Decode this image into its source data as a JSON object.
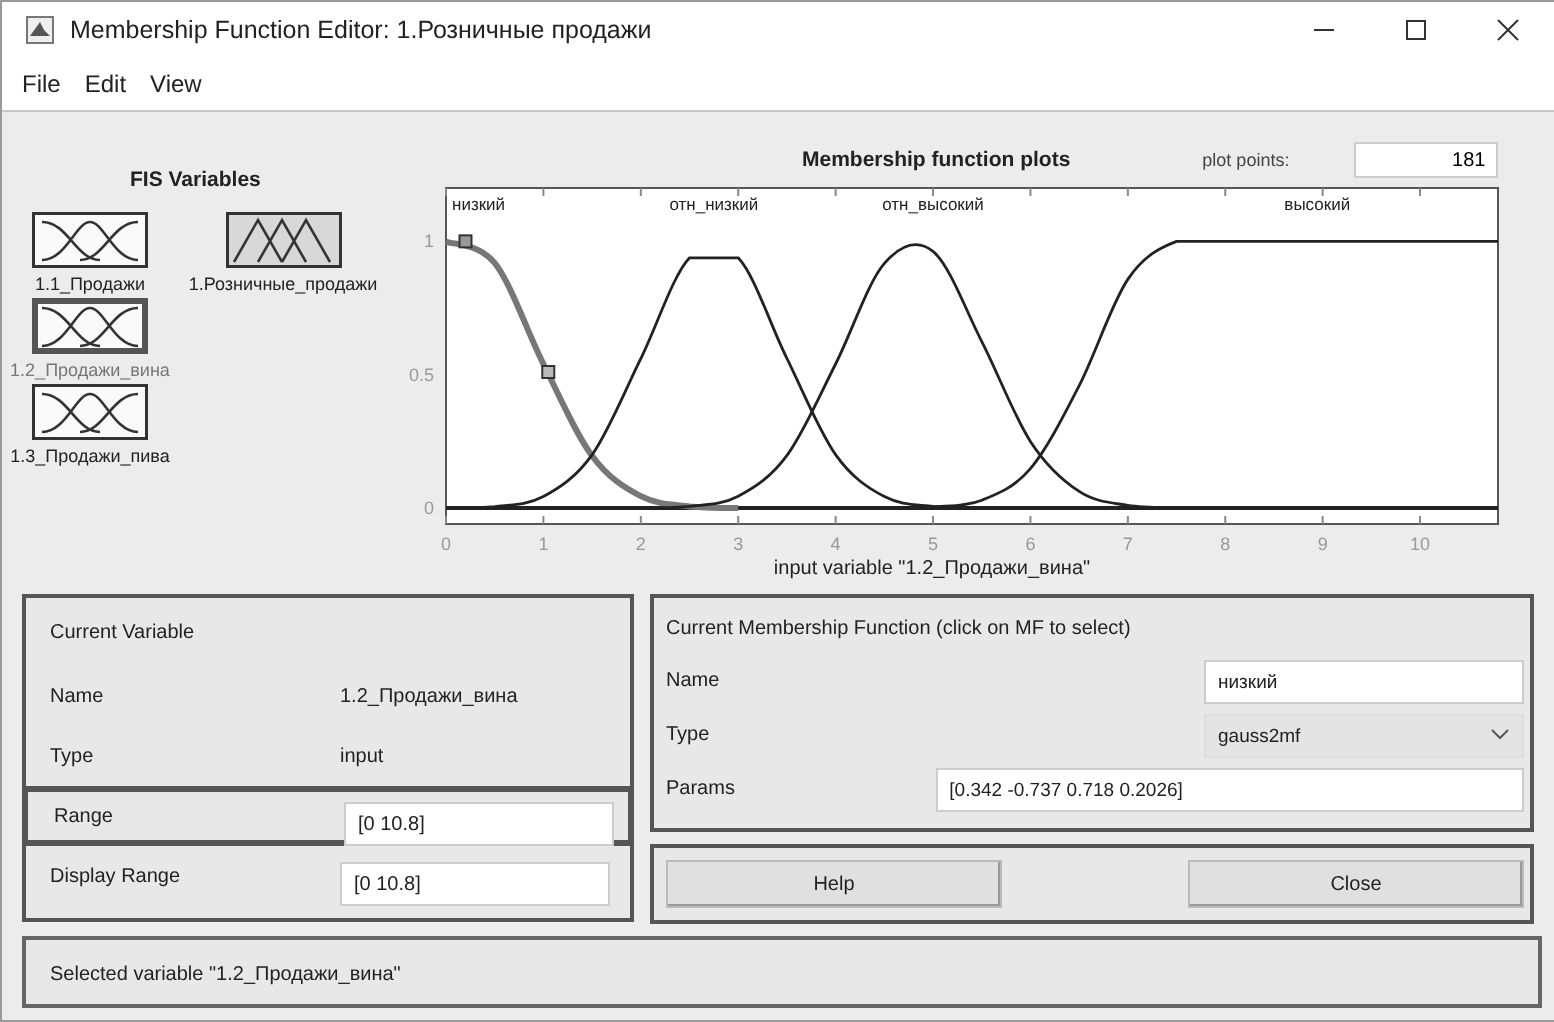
{
  "window": {
    "title": "Membership Function Editor: 1.Розничные продажи"
  },
  "menu": [
    {
      "label": "File"
    },
    {
      "label": "Edit"
    },
    {
      "label": "View"
    }
  ],
  "fis_variables": {
    "title": "FIS Variables",
    "items": [
      {
        "name": "1.1_Продажи",
        "kind": "input",
        "selected": false
      },
      {
        "name": "1.Розничные_продажи",
        "kind": "output",
        "selected": false
      },
      {
        "name": "1.2_Продажи_вина",
        "kind": "input",
        "selected": true
      },
      {
        "name": "1.3_Продажи_пива",
        "kind": "input",
        "selected": false
      }
    ]
  },
  "plot": {
    "plot_points_label": "plot points:",
    "plot_points": "181",
    "chart_data": {
      "type": "line",
      "title": "Membership function plots",
      "xlabel": "input variable \"1.2_Продажи_вина\"",
      "x": [
        0,
        0.5,
        1,
        1.5,
        2,
        2.5,
        3,
        3.5,
        4,
        4.5,
        5,
        5.5,
        6,
        6.5,
        7,
        7.5,
        8,
        8.5,
        9,
        9.5,
        10,
        10.5,
        10.8
      ],
      "series": [
        {
          "name": "низкий",
          "values": [
            1,
            0.918,
            0.54,
            0.195,
            0.044,
            0.006,
            0,
            null,
            null,
            null,
            null,
            null,
            null,
            null,
            null,
            null,
            null,
            null,
            null,
            null,
            null,
            null,
            null
          ]
        },
        {
          "name": "отн_низкий",
          "values": [
            0,
            0.005,
            0.043,
            0.2,
            0.56,
            0.938,
            0.938,
            0.56,
            0.2,
            0.043,
            0.006,
            0,
            null,
            null,
            null,
            null,
            null,
            null,
            null,
            null,
            null,
            null,
            null
          ]
        },
        {
          "name": "отн_высокий",
          "values": [
            null,
            null,
            null,
            null,
            0,
            0.006,
            0.044,
            0.197,
            0.54,
            0.917,
            0.962,
            0.624,
            0.25,
            0.062,
            0.01,
            0,
            null,
            null,
            null,
            null,
            null,
            null,
            null
          ]
        },
        {
          "name": "высокий",
          "values": [
            null,
            null,
            null,
            null,
            null,
            null,
            null,
            null,
            null,
            0,
            0.004,
            0.029,
            0.148,
            0.459,
            0.857,
            1,
            1,
            1,
            1,
            1,
            1,
            1,
            1
          ]
        }
      ],
      "xlim": [
        0,
        10.8
      ],
      "ylim": [
        -0.06,
        1.2
      ],
      "xticks": [
        0,
        1,
        2,
        3,
        4,
        5,
        6,
        7,
        8,
        9,
        10
      ],
      "yticks": [
        0,
        0.5,
        1
      ]
    },
    "curves": [
      {
        "selected": true
      },
      {
        "selected": false
      },
      {
        "selected": false
      },
      {
        "selected": false
      }
    ]
  },
  "current_variable": {
    "title": "Current Variable",
    "fields": [
      {
        "label": "Name",
        "value": "1.2_Продажи_вина",
        "kind": "text",
        "selected": false
      },
      {
        "label": "Type",
        "value": "input",
        "kind": "text",
        "selected": false
      },
      {
        "label": "Range",
        "value": "[0 10.8]",
        "kind": "input",
        "selected": true
      },
      {
        "label": "Display Range",
        "value": "[0 10.8]",
        "kind": "input",
        "selected": false
      }
    ]
  },
  "current_mf": {
    "title": "Current Membership Function (click on MF to select)",
    "name_label": "Name",
    "name": "низкий",
    "type_label": "Type",
    "type": "gauss2mf",
    "params_label": "Params",
    "params": "[0.342 -0.737 0.718 0.2026]"
  },
  "buttons": [
    {
      "label": "Help"
    },
    {
      "label": "Close"
    }
  ],
  "status": "Selected variable \"1.2_Продажи_вина\""
}
